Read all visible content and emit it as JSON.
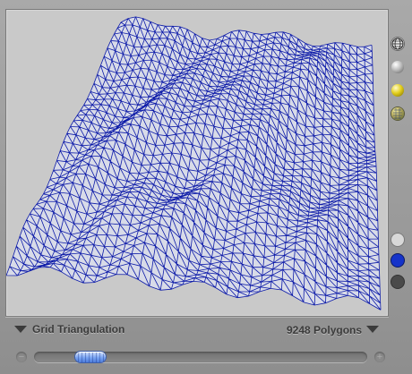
{
  "view": {
    "mesh_color": "#0c1aa8",
    "background_color": "#c9c9c9"
  },
  "side_buttons": [
    {
      "icon": "wireframe-globe-icon"
    },
    {
      "icon": "silver-sphere-icon"
    },
    {
      "icon": "gold-sphere-icon"
    },
    {
      "icon": "textured-sphere-icon"
    },
    {
      "icon": "white-color-swatch-icon",
      "color": "#d8d8d8"
    },
    {
      "icon": "blue-color-swatch-icon",
      "color": "#1533c9"
    },
    {
      "icon": "dark-color-swatch-icon",
      "color": "#4a4a4a"
    }
  ],
  "footer": {
    "mode_label": "Grid Triangulation",
    "polygon_count": "9248 Polygons"
  },
  "slider": {
    "value_fraction": 0.15
  }
}
